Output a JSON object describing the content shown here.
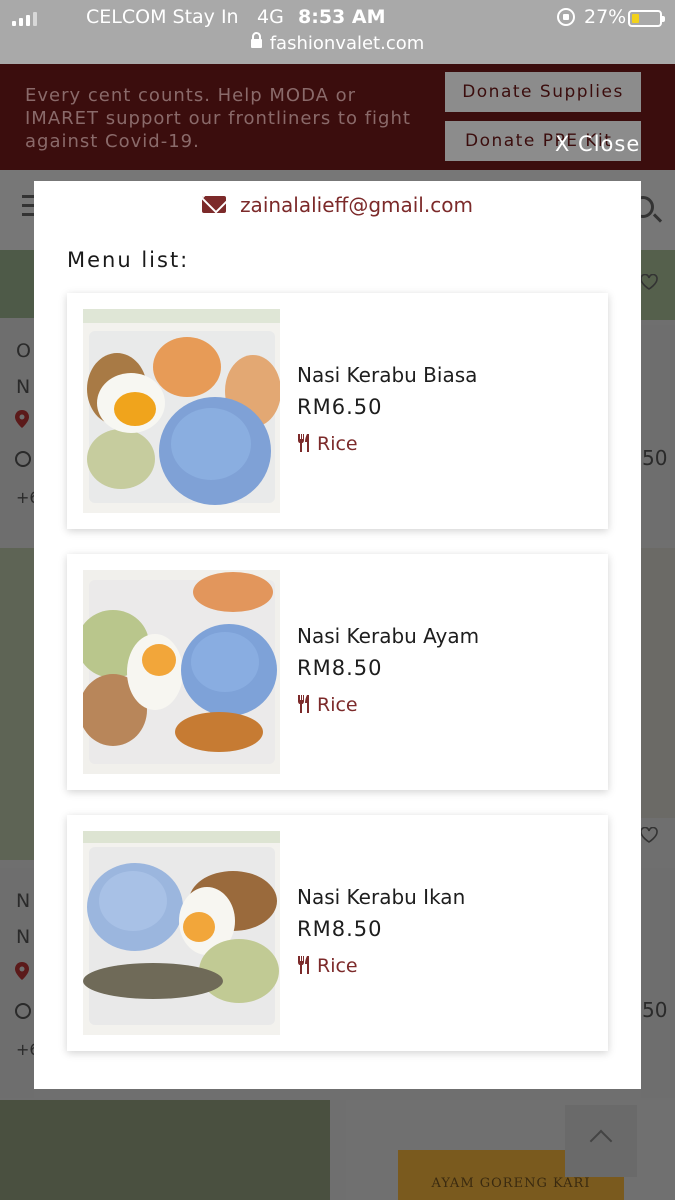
{
  "status_bar": {
    "carrier": "CELCOM Stay In",
    "network": "4G",
    "time": "8:53 AM",
    "battery_percent": "27%",
    "battery_level": 0.27,
    "url": "fashionvalet.com"
  },
  "background_page": {
    "banner_text": "Every cent counts. Help MODA or IMARET support our frontliners to fight against Covid-19.",
    "donate_supplies": "Donate Supplies",
    "donate_ppe": "Donate PPE Kit",
    "card1_lines": [
      "O",
      "N"
    ],
    "card1_phone": "+6",
    "card2_lines": [
      "N",
      "N"
    ],
    "card2_phone": "+6",
    "right_partial": "50",
    "ayam_banner": "AYAM GORENG KARI"
  },
  "modal": {
    "close_label": "X Close",
    "email": "zainalalieff@gmail.com",
    "menu_title": "Menu list:",
    "items": [
      {
        "name": "Nasi Kerabu Biasa",
        "price": "RM6.50",
        "category": "Rice"
      },
      {
        "name": "Nasi Kerabu Ayam",
        "price": "RM8.50",
        "category": "Rice"
      },
      {
        "name": "Nasi Kerabu Ikan",
        "price": "RM8.50",
        "category": "Rice"
      }
    ]
  },
  "colors": {
    "accent": "#7c2a2a",
    "banner": "#3b0d0d",
    "overlay": "#6f6f6f",
    "battery": "#f2d21b"
  },
  "icons": [
    "signal-icon",
    "lock-icon",
    "rotation-lock-icon",
    "battery-icon",
    "envelope-icon",
    "utensils-icon",
    "menu-icon",
    "search-icon",
    "heart-icon",
    "location-icon",
    "whatsapp-icon",
    "chevron-up-icon"
  ]
}
